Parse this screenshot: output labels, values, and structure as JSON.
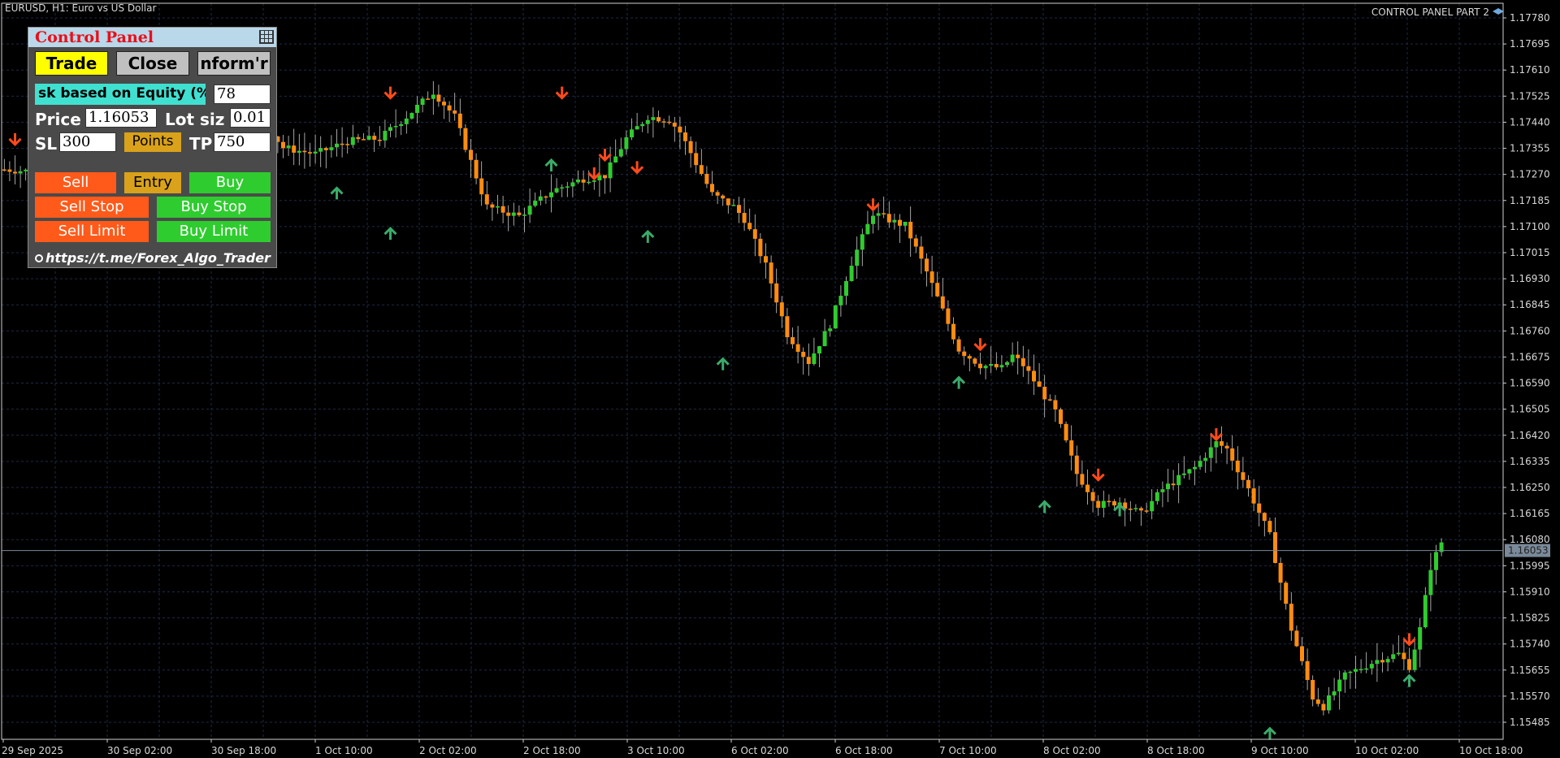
{
  "window": {
    "title": "EURUSD, H1:  Euro vs US Dollar",
    "right_label": "CONTROL PANEL PART 2",
    "right_icon": "graduation-cap-icon"
  },
  "panel": {
    "title": "Control Panel",
    "title_icon": "grid-icon",
    "tabs": [
      {
        "label": "Trade",
        "color": "#ffff00"
      },
      {
        "label": "Close",
        "color": "#c0c0c0"
      },
      {
        "label": "nform'r",
        "color": "#c0c0c0"
      }
    ],
    "risk_label": "sk based on Equity (%",
    "risk_value": "78",
    "price_label": "Price",
    "price_value": "1.16053",
    "lot_label": "Lot siz",
    "lot_value": "0.01",
    "sl_label": "SL",
    "sl_value": "300",
    "points_label": "Points",
    "tp_label": "TP",
    "tp_value": "750",
    "buttons": {
      "sell": "Sell",
      "entry": "Entry",
      "buy": "Buy",
      "sell_stop": "Sell Stop",
      "buy_stop": "Buy Stop",
      "sell_limit": "Sell Limit",
      "buy_limit": "Buy Limit"
    },
    "link": "https://t.me/Forex_Algo_Trader",
    "link_icon": "clock-icon"
  },
  "colors": {
    "bull": "#2fcc2f",
    "bear": "#ff8c10",
    "sell": "#ff5a1a",
    "buy": "#2fcc2f",
    "entry": "#d9a21a",
    "risk_bg": "#40e0d0",
    "grid": "#1d2a44",
    "up_arrow": "#3aaa6a",
    "down_arrow": "#ff4a1a"
  },
  "chart_data": {
    "type": "candlestick",
    "symbol": "EURUSD",
    "timeframe": "H1",
    "y_ticks": [
      "1.17780",
      "1.17695",
      "1.17610",
      "1.17525",
      "1.17440",
      "1.17355",
      "1.17270",
      "1.17185",
      "1.17100",
      "1.17015",
      "1.16930",
      "1.16845",
      "1.16760",
      "1.16675",
      "1.16590",
      "1.16505",
      "1.16420",
      "1.16335",
      "1.16250",
      "1.16165",
      "1.16080",
      "1.15995",
      "1.15910",
      "1.15825",
      "1.15740",
      "1.15655",
      "1.15570",
      "1.15485"
    ],
    "x_ticks": [
      "29 Sep 2025",
      "30 Sep 02:00",
      "30 Sep 18:00",
      "1 Oct 10:00",
      "2 Oct 02:00",
      "2 Oct 18:00",
      "3 Oct 10:00",
      "6 Oct 02:00",
      "6 Oct 18:00",
      "7 Oct 10:00",
      "8 Oct 02:00",
      "8 Oct 18:00",
      "9 Oct 10:00",
      "10 Oct 02:00",
      "10 Oct 18:00"
    ],
    "ylim": [
      1.15445,
      1.17815
    ],
    "current_price": "1.16053",
    "close_path": [
      [
        1.1728,
        0
      ],
      [
        1.1727,
        8
      ],
      [
        1.1731,
        12
      ],
      [
        1.1729,
        16
      ],
      [
        1.1737,
        22
      ],
      [
        1.1745,
        30
      ],
      [
        1.1754,
        38
      ],
      [
        1.1749,
        46
      ],
      [
        1.1735,
        52
      ],
      [
        1.1733,
        58
      ],
      [
        1.1737,
        64
      ],
      [
        1.1738,
        70
      ],
      [
        1.1745,
        75
      ],
      [
        1.1753,
        80
      ],
      [
        1.1745,
        84
      ],
      [
        1.1716,
        90
      ],
      [
        1.1713,
        96
      ],
      [
        1.1721,
        102
      ],
      [
        1.1725,
        108
      ],
      [
        1.1726,
        112
      ],
      [
        1.1738,
        116
      ],
      [
        1.1745,
        120
      ],
      [
        1.1744,
        124
      ],
      [
        1.174,
        126
      ],
      [
        1.172,
        132
      ],
      [
        1.1716,
        136
      ],
      [
        1.1712,
        138
      ],
      [
        1.1697,
        142
      ],
      [
        1.1675,
        146
      ],
      [
        1.1666,
        150
      ],
      [
        1.1678,
        154
      ],
      [
        1.1698,
        158
      ],
      [
        1.1714,
        162
      ],
      [
        1.1711,
        166
      ],
      [
        1.171,
        168
      ],
      [
        1.1695,
        172
      ],
      [
        1.167,
        178
      ],
      [
        1.1665,
        182
      ],
      [
        1.1664,
        186
      ],
      [
        1.1668,
        188
      ],
      [
        1.1665,
        190
      ],
      [
        1.165,
        196
      ],
      [
        1.163,
        200
      ],
      [
        1.162,
        204
      ],
      [
        1.1621,
        208
      ],
      [
        1.1617,
        212
      ],
      [
        1.1625,
        216
      ],
      [
        1.1632,
        222
      ],
      [
        1.164,
        226
      ],
      [
        1.1638,
        228
      ],
      [
        1.1625,
        232
      ],
      [
        1.161,
        236
      ],
      [
        1.158,
        240
      ],
      [
        1.1558,
        244
      ],
      [
        1.1555,
        246
      ],
      [
        1.1565,
        250
      ],
      [
        1.157,
        256
      ],
      [
        1.1572,
        260
      ],
      [
        1.1568,
        262
      ],
      [
        1.158,
        264
      ],
      [
        1.16,
        266
      ],
      [
        1.1608,
        268
      ]
    ],
    "down_arrows": [
      [
        1.1736,
        2
      ],
      [
        1.1751,
        72
      ],
      [
        1.1751,
        104
      ],
      [
        1.1725,
        110
      ],
      [
        1.1731,
        112
      ],
      [
        1.1727,
        118
      ],
      [
        1.1715,
        162
      ],
      [
        1.167,
        182
      ],
      [
        1.1628,
        204
      ],
      [
        1.1641,
        226
      ],
      [
        1.1575,
        262
      ]
    ],
    "up_arrows": [
      [
        1.1732,
        12
      ],
      [
        1.1718,
        30
      ],
      [
        1.1731,
        46
      ],
      [
        1.1722,
        62
      ],
      [
        1.1709,
        72
      ],
      [
        1.1731,
        102
      ],
      [
        1.1708,
        120
      ],
      [
        1.1667,
        134
      ],
      [
        1.1661,
        178
      ],
      [
        1.1621,
        194
      ],
      [
        1.162,
        208
      ],
      [
        1.1548,
        236
      ],
      [
        1.1565,
        262
      ]
    ]
  }
}
